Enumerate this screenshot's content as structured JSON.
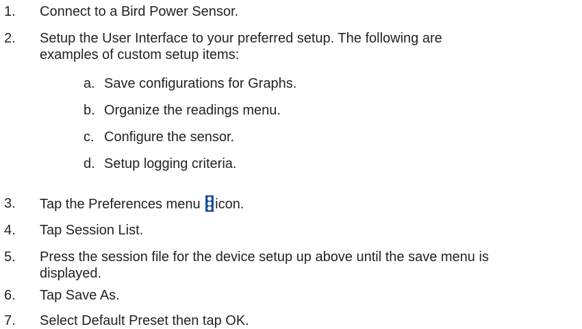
{
  "steps": [
    {
      "num": "1.",
      "text": "Connect to a Bird Power Sensor."
    },
    {
      "num": "2.",
      "line1": "Setup the User Interface to your preferred setup. The following are",
      "line2": "examples of custom setup items:"
    },
    {
      "num": "3.",
      "before": "Tap the Preferences menu",
      "after": "icon."
    },
    {
      "num": "4.",
      "text": "Tap Session List."
    },
    {
      "num": "5.",
      "line1": "Press the session file for the device setup up above until the save menu is",
      "line2": "displayed."
    },
    {
      "num": "6.",
      "text": "Tap Save As."
    },
    {
      "num": "7.",
      "text": "Select Default Preset then tap OK."
    }
  ],
  "substeps": [
    {
      "num": "a.",
      "text": "Save configurations for Graphs."
    },
    {
      "num": "b.",
      "text": "Organize the readings menu."
    },
    {
      "num": "c.",
      "text": "Configure the sensor."
    },
    {
      "num": "d.",
      "text": "Setup logging criteria."
    }
  ],
  "icons": {
    "preferences_menu": "kebab-menu-icon",
    "preferences_menu_color": "#1e4fa0"
  }
}
